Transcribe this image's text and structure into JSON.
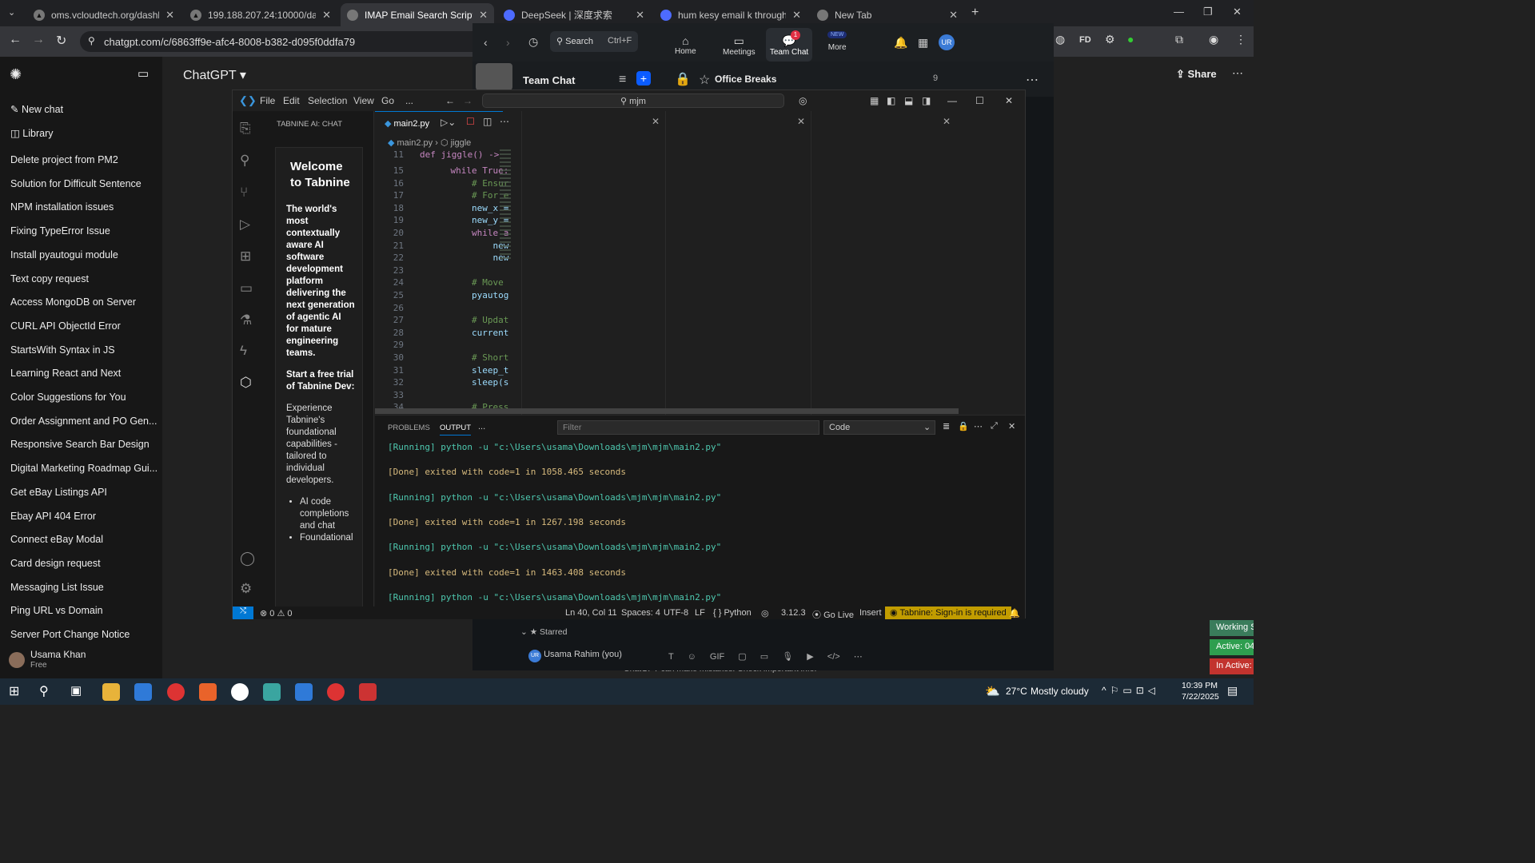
{
  "browser": {
    "tabs": [
      {
        "label": "oms.vcloudtech.org/dashboard"
      },
      {
        "label": "199.188.207.24:10000/dashboa"
      },
      {
        "label": "IMAP Email Search Script"
      },
      {
        "label": "DeepSeek | 深度求索"
      },
      {
        "label": "hum kesy email k through code"
      },
      {
        "label": "New Tab"
      }
    ],
    "url": "chatgpt.com/c/6863ff9e-afc4-8008-b382-d095f0ddfa79"
  },
  "chatgpt": {
    "model": "ChatGPT ▾",
    "new_chat": "New chat",
    "library": "Library",
    "share": "Share",
    "history": [
      "Delete project from PM2",
      "Solution for Difficult Sentence",
      "NPM installation issues",
      "Fixing TypeError Issue",
      "Install pyautogui module",
      "Text copy request",
      "Access MongoDB on Server",
      "CURL API ObjectId Error",
      "StartsWith Syntax in JS",
      "Learning React and Next",
      "Color Suggestions for You",
      "Order Assignment and PO Gen...",
      "Responsive Search Bar Design",
      "Digital Marketing Roadmap Gui...",
      "Get eBay Listings API",
      "Ebay API 404 Error",
      "Connect eBay Modal",
      "Card design request",
      "Messaging List Issue",
      "Ping URL vs Domain",
      "Server Port Change Notice"
    ],
    "user_name": "Usama Khan",
    "user_plan": "Free",
    "footer": "ChatGPT can make mistakes. Check important info."
  },
  "vscode": {
    "menu": [
      "File",
      "Edit",
      "Selection",
      "View",
      "Go",
      "..."
    ],
    "search": "mjm",
    "sidebar_title": "TABNINE AI: CHAT",
    "tab": "main2.py",
    "breadcrumb": [
      "main2.py",
      "jiggle"
    ],
    "tabnine": {
      "welcome": "Welcome to Tabnine",
      "desc": "The world's most contextually aware AI software development platform delivering the next generation of agentic AI for mature engineering teams.",
      "trial": "Start a free trial of Tabnine Dev:",
      "exp": "Experience Tabnine's foundational capabilities - tailored to individual developers.",
      "b1": "AI code completions and chat",
      "b2": "Foundational"
    },
    "lines": [
      {
        "n": "11",
        "t": "def jiggle() ->"
      },
      {
        "n": "15",
        "t": "    while True:"
      },
      {
        "n": "16",
        "t": "        # Ensur"
      },
      {
        "n": "17",
        "t": "        # For e"
      },
      {
        "n": "18",
        "t": "        new_x ="
      },
      {
        "n": "19",
        "t": "        new_y ="
      },
      {
        "n": "20",
        "t": "        while a"
      },
      {
        "n": "21",
        "t": "            new"
      },
      {
        "n": "22",
        "t": "            new"
      },
      {
        "n": "23",
        "t": ""
      },
      {
        "n": "24",
        "t": "        # Move"
      },
      {
        "n": "25",
        "t": "        pyautog"
      },
      {
        "n": "26",
        "t": ""
      },
      {
        "n": "27",
        "t": "        # Updat"
      },
      {
        "n": "28",
        "t": "        current"
      },
      {
        "n": "29",
        "t": ""
      },
      {
        "n": "30",
        "t": "        # Short"
      },
      {
        "n": "31",
        "t": "        sleep_t"
      },
      {
        "n": "32",
        "t": "        sleep(s"
      },
      {
        "n": "33",
        "t": ""
      },
      {
        "n": "34",
        "t": "        # Press"
      }
    ],
    "panel_tabs": [
      "PROBLEMS",
      "OUTPUT",
      "..."
    ],
    "filter": "Filter",
    "channel": "Code",
    "output": [
      {
        "kind": "run",
        "text": "[Running] python -u \"c:\\Users\\usama\\Downloads\\mjm\\mjm\\main2.py\""
      },
      {
        "kind": "done",
        "text": "[Done] exited with code=1 in 1058.465 seconds"
      },
      {
        "kind": "run",
        "text": "[Running] python -u \"c:\\Users\\usama\\Downloads\\mjm\\mjm\\main2.py\""
      },
      {
        "kind": "done",
        "text": "[Done] exited with code=1 in 1267.198 seconds"
      },
      {
        "kind": "run",
        "text": "[Running] python -u \"c:\\Users\\usama\\Downloads\\mjm\\mjm\\main2.py\""
      },
      {
        "kind": "done",
        "text": "[Done] exited with code=1 in 1463.408 seconds"
      },
      {
        "kind": "run",
        "text": "[Running] python -u \"c:\\Users\\usama\\Downloads\\mjm\\mjm\\main2.py\""
      }
    ],
    "status": {
      "errors": "⊗ 0 ⚠ 0",
      "pos": "Ln 40, Col 11",
      "spaces": "Spaces: 4",
      "enc": "UTF-8",
      "eol": "LF",
      "lang": "{ } Python",
      "ver": "3.12.3",
      "live": "Go Live",
      "mode": "Insert",
      "tabnine": "Tabnine: Sign-in is required"
    }
  },
  "zoom": {
    "search": "Search",
    "shortcut": "Ctrl+F",
    "nav": [
      "Home",
      "Meetings",
      "Team Chat",
      "More"
    ],
    "new_badge": "NEW",
    "chat_badge": "1",
    "team_chat": "Team Chat",
    "channel": "Office Breaks",
    "members": "9",
    "starred": "Starred",
    "user": "Usama Rahim (you)",
    "gif": "GIF"
  },
  "side_right": {
    "a": "Working S",
    "b": "Active: 04",
    "c": "In Active:"
  },
  "taskbar": {
    "temp": "27°C",
    "weather": "Mostly cloudy",
    "time": "10:39 PM",
    "date": "7/22/2025"
  }
}
